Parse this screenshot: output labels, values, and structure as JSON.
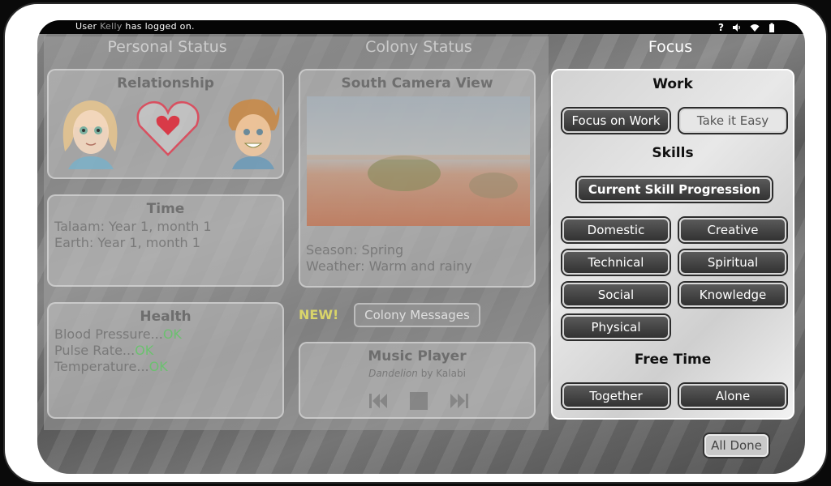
{
  "status_bar": {
    "login_prefix": "User ",
    "login_user": "Kelly",
    "login_suffix": " has logged on.",
    "help_symbol": "?",
    "icons": [
      "help-icon",
      "volume-icon",
      "wifi-icon",
      "battery-icon"
    ]
  },
  "columns": {
    "personal": "Personal Status",
    "colony": "Colony Status",
    "focus": "Focus"
  },
  "relationship": {
    "title": "Relationship",
    "icons": [
      "girl-portrait",
      "heart-icon",
      "boy-portrait"
    ]
  },
  "time": {
    "title": "Time",
    "talaam": "Talaam: Year 1, month 1",
    "earth": "Earth: Year 1, month 1"
  },
  "health": {
    "title": "Health",
    "rows": [
      {
        "label": "Blood Pressure...",
        "value": "OK"
      },
      {
        "label": "Pulse Rate...",
        "value": "OK"
      },
      {
        "label": "Temperature...",
        "value": "OK"
      }
    ],
    "ok_color": "#6cc070"
  },
  "camera": {
    "title": "South Camera View",
    "season": "Season: Spring",
    "weather": "Weather: Warm and rainy"
  },
  "messages": {
    "new_label": "NEW!",
    "button": "Colony Messages"
  },
  "music": {
    "title": "Music Player",
    "song": "Dandelion",
    "by": " by ",
    "artist": "Kalabi",
    "controls": [
      "previous-icon",
      "stop-icon",
      "next-icon"
    ]
  },
  "focus": {
    "work_title": "Work",
    "work_buttons": [
      "Focus on Work",
      "Take it Easy"
    ],
    "skills_title": "Skills",
    "skill_progression": "Current Skill Progression",
    "skills": [
      "Domestic",
      "Creative",
      "Technical",
      "Spiritual",
      "Social",
      "Knowledge",
      "Physical"
    ],
    "free_time_title": "Free Time",
    "free_time_buttons": [
      "Together",
      "Alone"
    ]
  },
  "all_done": "All Done"
}
